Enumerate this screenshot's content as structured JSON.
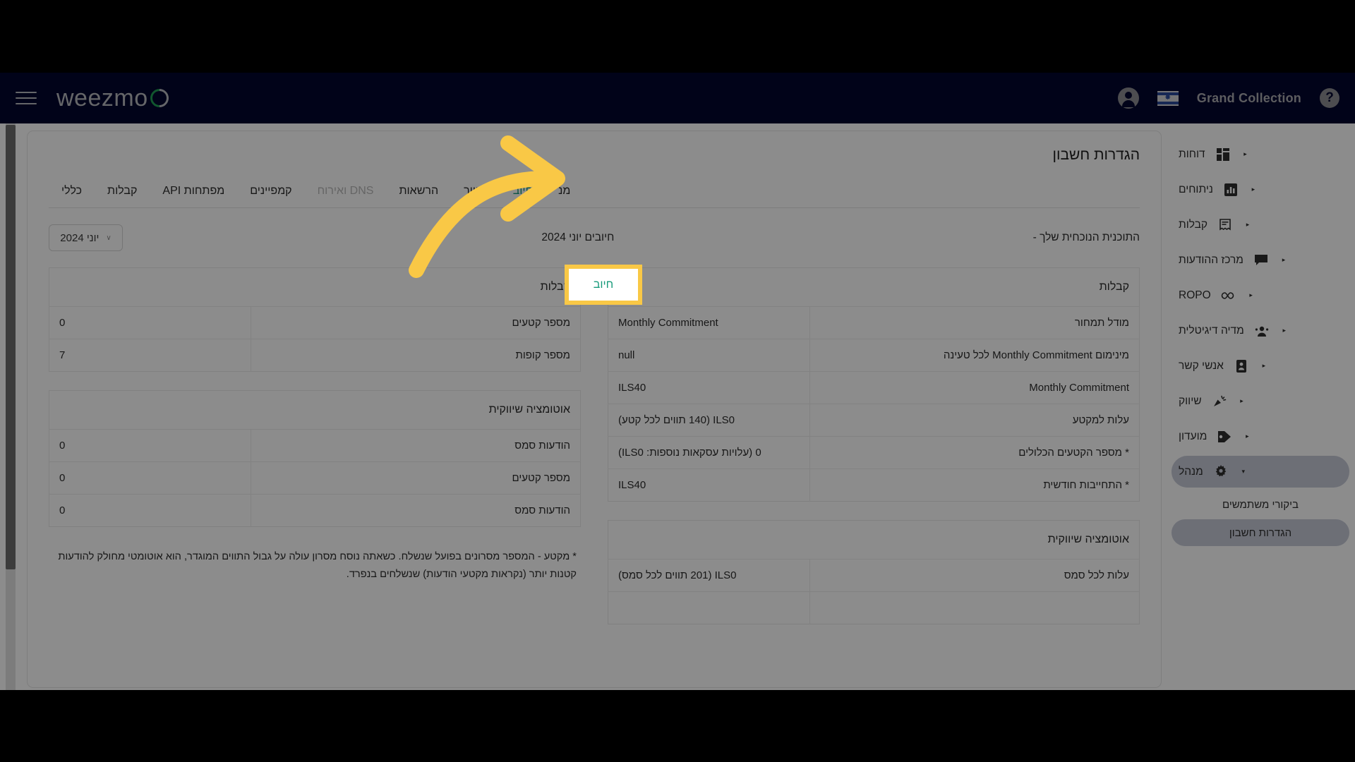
{
  "navbar": {
    "brand": "Grand Collection",
    "help": "?",
    "logo": "weezmo",
    "account_icon": "account-circle-icon",
    "flag_icon": "israel-flag-icon",
    "menu_icon": "hamburger-menu-icon"
  },
  "sidebar": {
    "items": [
      {
        "label": "דוחות",
        "icon": "dashboard-icon",
        "arrow": "▸",
        "active": false
      },
      {
        "label": "ניתוחים",
        "icon": "bar-chart-icon",
        "arrow": "▸",
        "active": false
      },
      {
        "label": "קבלות",
        "icon": "receipt-icon",
        "arrow": "▸",
        "active": false
      },
      {
        "label": "מרכז ההודעות",
        "icon": "message-icon",
        "arrow": "▸",
        "active": false
      },
      {
        "label": "ROPO",
        "icon": "infinity-icon",
        "arrow": "▸",
        "active": false
      },
      {
        "label": "מדיה דיגיטלית",
        "icon": "people-icon",
        "arrow": "▸",
        "active": false
      },
      {
        "label": "אנשי קשר",
        "icon": "contacts-icon",
        "arrow": "▸",
        "active": false
      },
      {
        "label": "שיווק",
        "icon": "megaphone-icon",
        "arrow": "▸",
        "active": false
      },
      {
        "label": "מועדון",
        "icon": "tag-icon",
        "arrow": "▸",
        "active": false
      },
      {
        "label": "מנהל",
        "icon": "gear-icon",
        "arrow": "▾",
        "active": true
      }
    ],
    "subitems": [
      {
        "label": "ביקורי משתמשים",
        "selected": false
      },
      {
        "label": "הגדרות חשבון",
        "selected": true
      }
    ]
  },
  "card": {
    "title": "הגדרות חשבון",
    "tabs": [
      {
        "label": "כללי",
        "state": "normal"
      },
      {
        "label": "קבלות",
        "state": "normal"
      },
      {
        "label": "מפתחות API",
        "state": "normal"
      },
      {
        "label": "קמפיינים",
        "state": "normal"
      },
      {
        "label": "DNS ואירוח",
        "state": "disabled"
      },
      {
        "label": "הרשאות",
        "state": "normal"
      },
      {
        "label": "חניוך",
        "state": "normal"
      },
      {
        "label": "חיוב",
        "state": "selected"
      },
      {
        "label": "מנ",
        "state": "normal"
      }
    ],
    "plan_text": "התוכנית הנוכחית שלך -",
    "period_text": "חיובים יוני 2024",
    "month_select": {
      "value": "יוני 2024",
      "chevron": "∨"
    }
  },
  "right_column": {
    "tables": [
      {
        "header": "קבלות",
        "rows": [
          {
            "key": "מודל תמחור",
            "value": "Monthly Commitment"
          },
          {
            "key": "מינימום Monthly Commitment לכל טעינה",
            "value": "null"
          },
          {
            "key": "Monthly Commitment",
            "value": "ILS40"
          },
          {
            "key": "עלות למקטע",
            "value": "ILS0 (140 תווים לכל קטע)"
          },
          {
            "key": "* מספר הקטעים הכלולים",
            "value": "0 (עלויות עסקאות נוספות: ILS0)"
          },
          {
            "key": "* התחייבות חודשית",
            "value": "ILS40"
          }
        ]
      },
      {
        "header": "אוטומציה שיווקית",
        "rows": [
          {
            "key": "עלות לכל סמס",
            "value": "ILS0 (201 תווים לכל סמס)"
          }
        ]
      }
    ]
  },
  "left_column": {
    "tables": [
      {
        "header": "קבלות",
        "rows": [
          {
            "key": "מספר קטעים",
            "value": "0"
          },
          {
            "key": "מספר קופות",
            "value": "7"
          }
        ]
      },
      {
        "header": "אוטומציה שיווקית",
        "rows": [
          {
            "key": "הודעות סמס",
            "value": "0"
          },
          {
            "key": "מספר קטעים",
            "value": "0"
          },
          {
            "key": "הודעות סמס",
            "value": "0"
          }
        ]
      }
    ],
    "note": "* מקטע - המספר מסרונים בפועל שנשלח. כשאתה נוסח מסרון עולה על גבול התווים המוגדר, הוא אוטומטי מחולק להודעות קטנות יותר (נקראות מקטעי הודעות) שנשלחים בנפרד."
  },
  "annotation": {
    "highlight_label": "חיוב",
    "arrow_color": "#f9c846",
    "highlight_border_color": "#f9c846",
    "highlight_text_color": "#179a7a"
  }
}
